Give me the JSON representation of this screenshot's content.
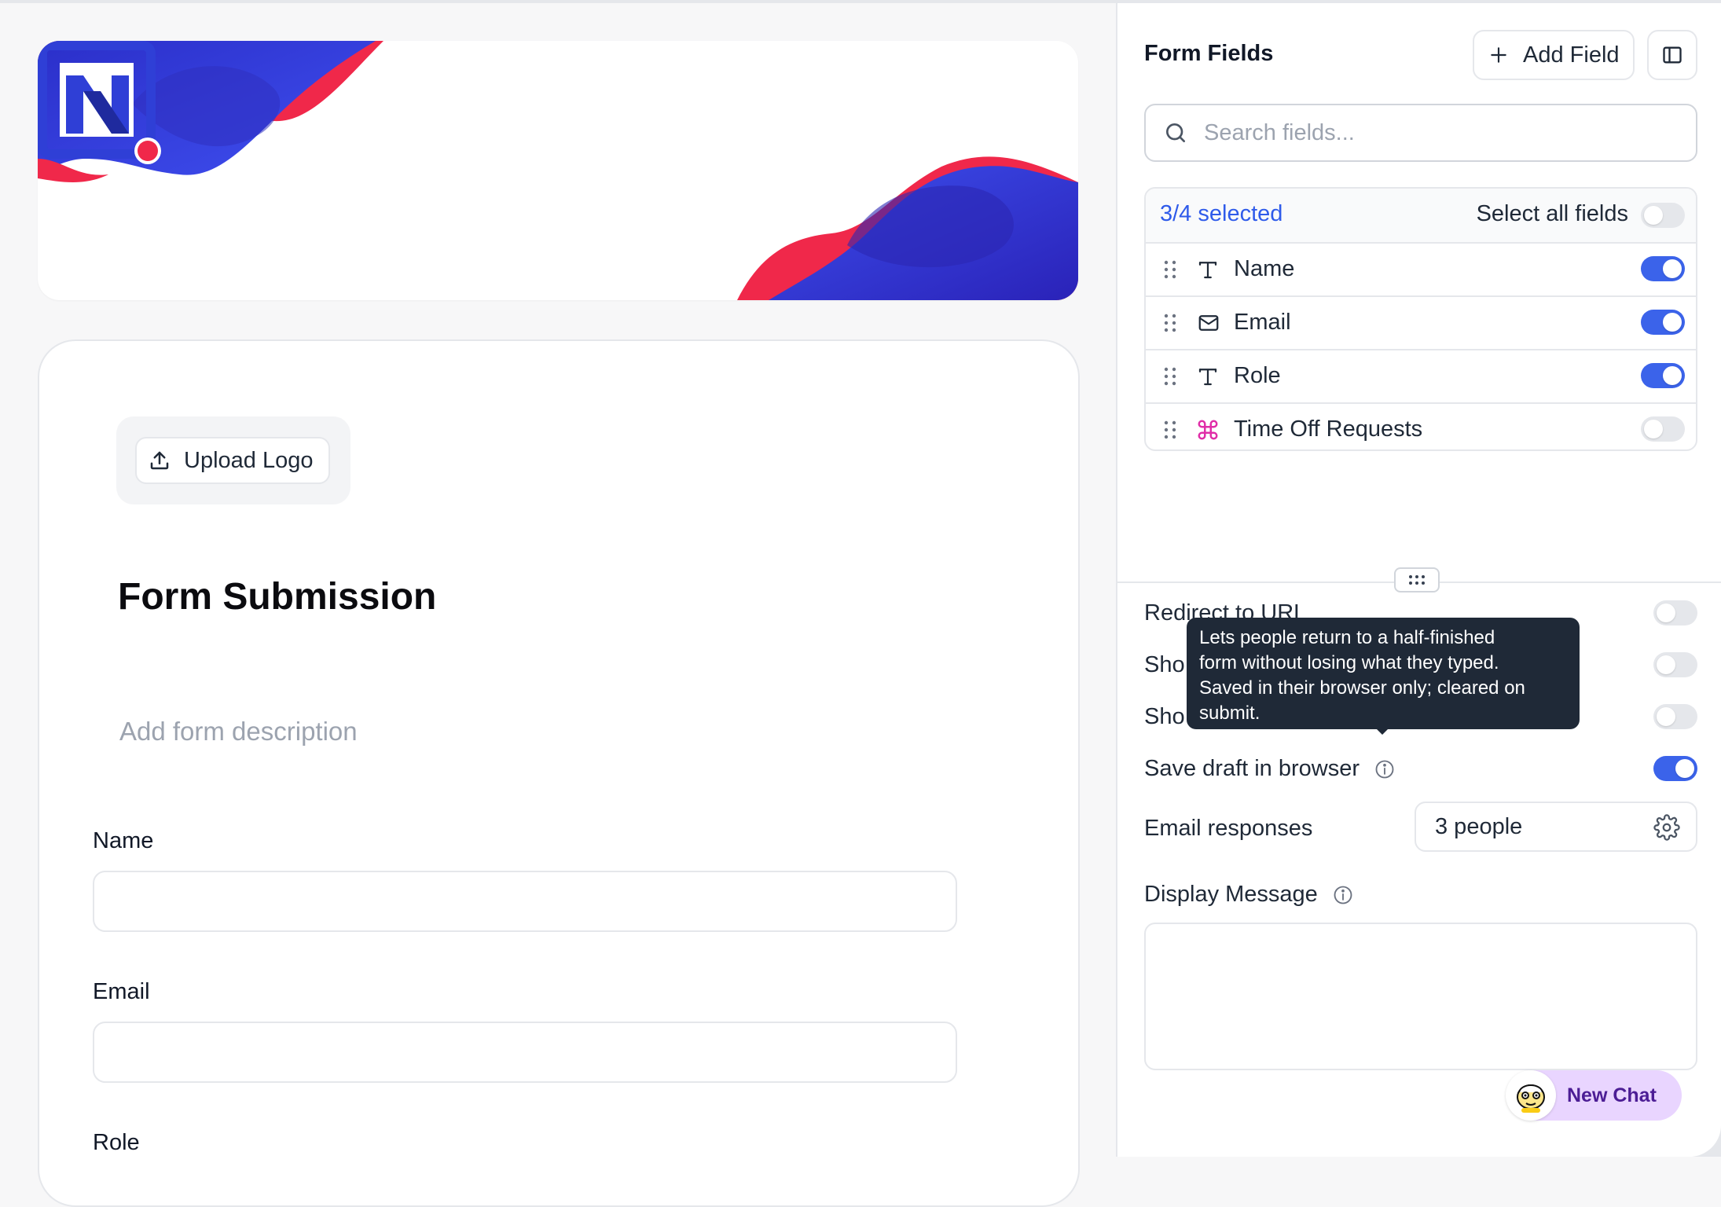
{
  "preview": {
    "upload_logo_label": "Upload Logo",
    "form_title": "Form Submission",
    "form_description_placeholder": "Add form description",
    "fields": [
      {
        "label": "Name"
      },
      {
        "label": "Email"
      },
      {
        "label": "Role"
      }
    ]
  },
  "panel": {
    "title": "Form Fields",
    "add_field_label": "Add Field",
    "search_placeholder": "Search fields...",
    "selected_count": "3/4 selected",
    "select_all_label": "Select all fields",
    "select_all_enabled": false,
    "fields": [
      {
        "name": "Name",
        "icon": "text-type-icon",
        "enabled": true
      },
      {
        "name": "Email",
        "icon": "mail-icon",
        "enabled": true
      },
      {
        "name": "Role",
        "icon": "text-type-icon",
        "enabled": true
      },
      {
        "name": "Time Off Requests",
        "icon": "command-icon",
        "enabled": false
      }
    ],
    "settings": [
      {
        "label": "Redirect to URL",
        "enabled": false
      },
      {
        "label": "Sho",
        "enabled": false
      },
      {
        "label": "Sho",
        "enabled": false
      },
      {
        "label": "Save draft in browser",
        "enabled": true
      }
    ],
    "email_responses_label": "Email responses",
    "email_responses_value": "3 people",
    "display_message_label": "Display Message"
  },
  "tooltip": {
    "lines": [
      "Lets people return to a half-finished",
      "form without losing what they typed.",
      "Saved in their browser only; cleared on",
      "submit."
    ]
  },
  "chat": {
    "new_chat_label": "New Chat"
  },
  "colors": {
    "accent": "#3b63ea",
    "brand_blue": "#2f3fd6",
    "brand_red": "#f0284a",
    "tooltip_bg": "#1f2937",
    "chat_bg": "#e9d5ff"
  }
}
